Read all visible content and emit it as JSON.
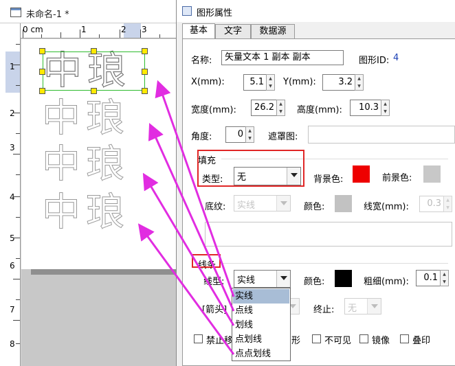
{
  "doc": {
    "title": "未命名-1 *",
    "ruler_top": [
      "0 cm",
      "1",
      "2",
      "3"
    ],
    "ruler_left": [
      "1",
      "2",
      "3",
      "4",
      "5",
      "6",
      "7",
      "8"
    ],
    "glyph_text": "中琅"
  },
  "dialog": {
    "title": "图形属性",
    "tabs": [
      "基本",
      "文字",
      "数据源"
    ],
    "name_label": "名称:",
    "name_value": "矢量文本 1 副本 副本",
    "id_label": "图形ID:",
    "id_value": "4",
    "x_label": "X(mm):",
    "x_value": "5.1",
    "y_label": "Y(mm):",
    "y_value": "3.2",
    "width_label": "宽度(mm):",
    "width_value": "26.2",
    "height_label": "高度(mm):",
    "height_value": "10.3",
    "angle_label": "角度:",
    "angle_value": "0",
    "mask_label": "遮罩图:",
    "fill": {
      "group_title": "填充",
      "type_label": "类型:",
      "type_value": "无",
      "bg_label": "背景色:",
      "bg_color": "#ee0000",
      "fg_label": "前景色:",
      "fg_color": "#c8c8c8",
      "pattern_label": "底纹:",
      "pattern_value": "实线",
      "color_label": "颜色:",
      "color_value": "#c2c2c2",
      "linewidth_label": "线宽(mm):",
      "linewidth_value": "0.3"
    },
    "line": {
      "group_title": "线条",
      "type_label": "线型:",
      "type_value": "实线",
      "color_label": "颜色:",
      "color_value": "#000000",
      "thickness_label": "粗细(mm):",
      "thickness_value": "0.1",
      "arrow_label": "箭头",
      "end_label": "终止:",
      "end_value": "无"
    },
    "line_type_options": [
      "实线",
      "点线",
      "划线",
      "点划线",
      "点点划线"
    ],
    "checkboxes": {
      "no_move_partial": "禁止移",
      "shape_partial": "形",
      "invisible": "不可见",
      "mirror": "镜像",
      "print_partial": "叠印"
    }
  },
  "colors": {
    "highlight_box": "#e02626",
    "arrow": "#e12de1",
    "selection": "#2dbb2d",
    "handle": "#ffea00"
  }
}
